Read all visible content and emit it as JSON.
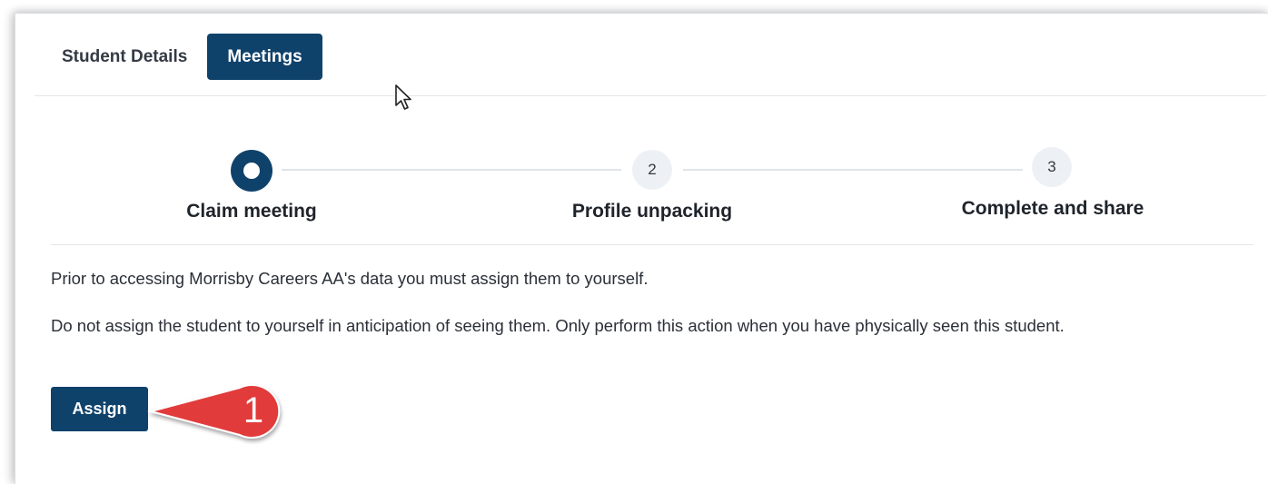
{
  "tabs": [
    {
      "label": "Student Details",
      "active": false
    },
    {
      "label": "Meetings",
      "active": true
    }
  ],
  "stepper": {
    "steps": [
      {
        "number": "",
        "label": "Claim meeting",
        "state": "current"
      },
      {
        "number": "2",
        "label": "Profile unpacking",
        "state": "pending"
      },
      {
        "number": "3",
        "label": "Complete and share",
        "state": "pending"
      }
    ]
  },
  "content": {
    "paragraph1": "Prior to accessing Morrisby Careers AA's data you must assign them to yourself.",
    "paragraph2": "Do not assign the student to yourself in anticipation of seeing them. Only perform this action when you have physically seen this student.",
    "assign_label": "Assign"
  },
  "annotation": {
    "number": "1",
    "color": "#e23b3b"
  },
  "colors": {
    "primary": "#0f426b",
    "step_pending_bg": "#edf1f5"
  },
  "icons": {
    "cursor": "mouse-pointer-icon",
    "callout": "callout-arrow-icon"
  }
}
